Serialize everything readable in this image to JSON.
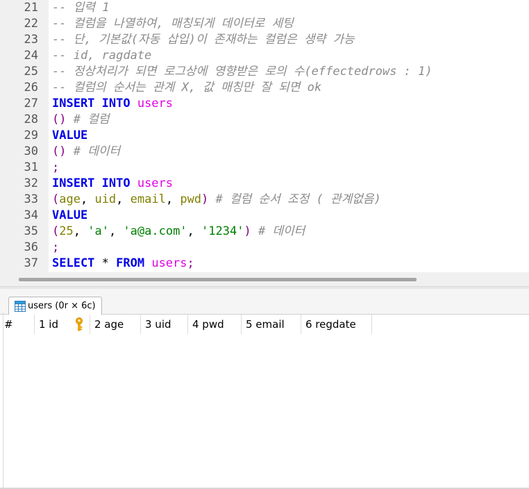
{
  "editor": {
    "lines": [
      {
        "n": "21",
        "parts": [
          {
            "cls": "c",
            "text": "-- 입력 1"
          }
        ]
      },
      {
        "n": "22",
        "parts": [
          {
            "cls": "c",
            "text": "-- 컬럼을 나열하여, 매칭되게 데이터로 세팅"
          }
        ]
      },
      {
        "n": "23",
        "parts": [
          {
            "cls": "c",
            "text": "-- 단, 기본값(자동 삽입)이 존재하는 컬럼은 생략 가능"
          }
        ]
      },
      {
        "n": "24",
        "parts": [
          {
            "cls": "c",
            "text": "-- id, ragdate"
          }
        ]
      },
      {
        "n": "25",
        "parts": [
          {
            "cls": "c",
            "text": "-- 정상처리가 되면 로그상에 영향받은 로의 수(effectedrows : 1)"
          }
        ]
      },
      {
        "n": "26",
        "parts": [
          {
            "cls": "c",
            "text": "-- 컬럼의 순서는 관계 X, 값 매칭만 잘 되면 ok"
          }
        ]
      },
      {
        "n": "27",
        "parts": [
          {
            "cls": "k",
            "text": "INSERT INTO "
          },
          {
            "cls": "t",
            "text": "users"
          }
        ]
      },
      {
        "n": "28",
        "parts": [
          {
            "cls": "p",
            "text": "() "
          },
          {
            "cls": "c",
            "text": "# 컬럼"
          }
        ]
      },
      {
        "n": "29",
        "parts": [
          {
            "cls": "k",
            "text": "VALUE"
          }
        ]
      },
      {
        "n": "30",
        "parts": [
          {
            "cls": "p",
            "text": "() "
          },
          {
            "cls": "c",
            "text": "# 데이터"
          }
        ]
      },
      {
        "n": "31",
        "parts": [
          {
            "cls": "p",
            "text": ";"
          }
        ]
      },
      {
        "n": "32",
        "parts": [
          {
            "cls": "k",
            "text": "INSERT INTO "
          },
          {
            "cls": "t",
            "text": "users"
          }
        ]
      },
      {
        "n": "33",
        "parts": [
          {
            "cls": "p",
            "text": "("
          },
          {
            "cls": "n",
            "text": "age"
          },
          {
            "cls": "",
            "text": ", "
          },
          {
            "cls": "n",
            "text": "uid"
          },
          {
            "cls": "",
            "text": ", "
          },
          {
            "cls": "n",
            "text": "email"
          },
          {
            "cls": "",
            "text": ", "
          },
          {
            "cls": "n",
            "text": "pwd"
          },
          {
            "cls": "p",
            "text": ") "
          },
          {
            "cls": "c",
            "text": "# 컬럼 순서 조정 ( 관계없음)"
          }
        ]
      },
      {
        "n": "34",
        "parts": [
          {
            "cls": "k",
            "text": "VALUE"
          }
        ]
      },
      {
        "n": "35",
        "parts": [
          {
            "cls": "p",
            "text": "("
          },
          {
            "cls": "n",
            "text": "25"
          },
          {
            "cls": "",
            "text": ", "
          },
          {
            "cls": "s",
            "text": "'a'"
          },
          {
            "cls": "",
            "text": ", "
          },
          {
            "cls": "s",
            "text": "'a@a.com'"
          },
          {
            "cls": "",
            "text": ", "
          },
          {
            "cls": "s",
            "text": "'1234'"
          },
          {
            "cls": "p",
            "text": ") "
          },
          {
            "cls": "c",
            "text": "# 데이터"
          }
        ]
      },
      {
        "n": "36",
        "parts": [
          {
            "cls": "p",
            "text": ";"
          }
        ]
      },
      {
        "n": "37",
        "parts": [
          {
            "cls": "k",
            "text": "SELECT "
          },
          {
            "cls": "",
            "text": "* "
          },
          {
            "cls": "k",
            "text": "FROM "
          },
          {
            "cls": "t",
            "text": "users"
          },
          {
            "cls": "p",
            "text": ";"
          }
        ]
      }
    ]
  },
  "result": {
    "tab_label": "users (0r × 6c)",
    "columns": [
      {
        "label": "#",
        "width": 50
      },
      {
        "label": "1 id",
        "width": 80,
        "key": true
      },
      {
        "label": "2 age",
        "width": 73
      },
      {
        "label": "3 uid",
        "width": 68
      },
      {
        "label": "4 pwd",
        "width": 77
      },
      {
        "label": "5 email",
        "width": 86
      },
      {
        "label": "6 regdate",
        "width": 102
      }
    ]
  },
  "colors": {
    "keyword": "#0000e6",
    "table": "#e000e0",
    "string": "#008000",
    "column": "#808000",
    "comment": "#8c8c8c"
  }
}
